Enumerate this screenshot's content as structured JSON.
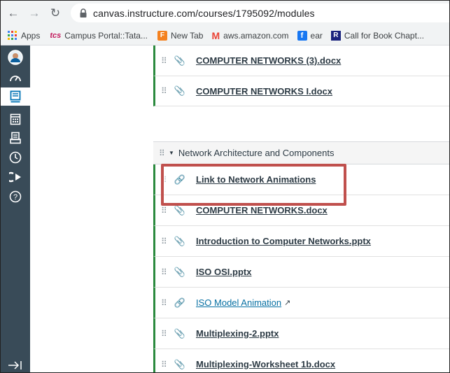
{
  "browser": {
    "url": "canvas.instructure.com/courses/1795092/modules",
    "bookmarks": [
      {
        "label": "Apps",
        "icon": "apps-grid-icon"
      },
      {
        "label": "Campus Portal::Tata...",
        "icon": "tcs-icon"
      },
      {
        "label": "New Tab",
        "icon": "new-tab-icon"
      },
      {
        "label": "aws.amazon.com",
        "icon": "gmail-icon"
      },
      {
        "label": "ear",
        "icon": "facebook-icon"
      },
      {
        "label": "Call for Book Chapt...",
        "icon": "r-bookmark-icon"
      }
    ]
  },
  "module1": {
    "items": [
      {
        "title": "COMPUTER NETWORKS (3).docx",
        "type": "attachment"
      },
      {
        "title": "COMPUTER NETWORKS I.docx",
        "type": "attachment"
      }
    ]
  },
  "module2": {
    "title": "Network Architecture and Components",
    "items": [
      {
        "title": "Link to Network Animations",
        "type": "link"
      },
      {
        "title": "COMPUTER NETWORKS.docx",
        "type": "attachment"
      },
      {
        "title": "Introduction to Computer Networks.pptx",
        "type": "attachment"
      },
      {
        "title": "ISO OSI.pptx",
        "type": "attachment"
      },
      {
        "title": "ISO Model Animation",
        "type": "external-link"
      },
      {
        "title": "Multiplexing-2.pptx",
        "type": "attachment"
      },
      {
        "title": "Multiplexing-Worksheet 1b.docx",
        "type": "attachment"
      }
    ]
  },
  "colors": {
    "nav_bg": "#394b58",
    "module_accent": "#2b8a3e",
    "highlight": "#c0504d",
    "link": "#0770a3"
  }
}
